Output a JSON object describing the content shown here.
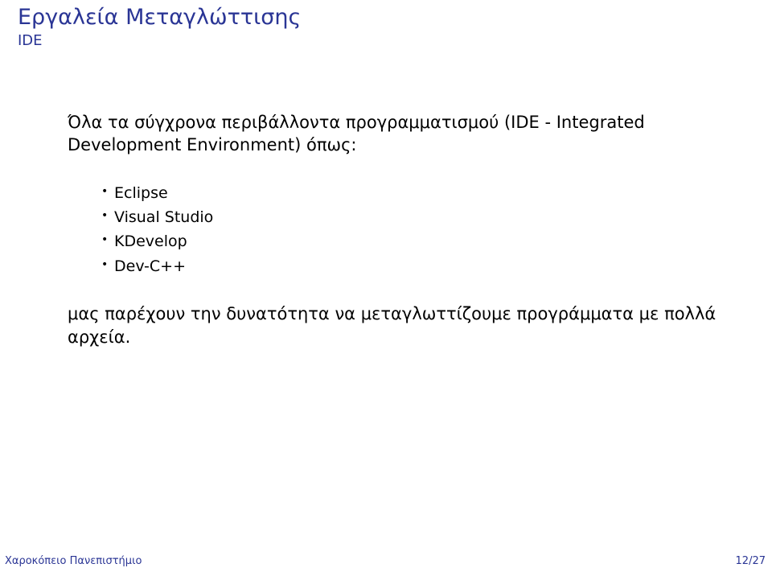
{
  "header": {
    "title": "Εργαλεία Μεταγλώττισης",
    "subtitle": "IDE"
  },
  "content": {
    "intro": "Όλα τα σύγχρονα περιβάλλοντα προγραμματισμού (IDE - Integrated Development Environment) όπως:",
    "items": [
      "Eclipse",
      "Visual Studio",
      "KDevelop",
      "Dev-C++"
    ],
    "outro": "μας παρέχουν την δυνατότητα να μεταγλωττίζουμε προγράμματα με πολλά αρχεία."
  },
  "footer": {
    "left": "Χαροκόπειο Πανεπιστήμιο",
    "right": "12/27"
  }
}
